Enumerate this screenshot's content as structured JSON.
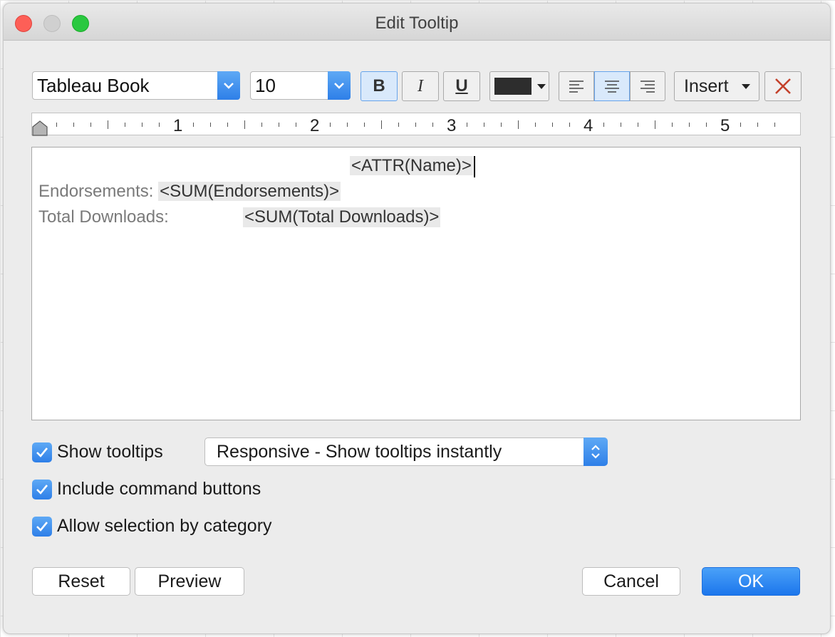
{
  "window": {
    "title": "Edit Tooltip"
  },
  "toolbar": {
    "font_family": "Tableau Book",
    "font_size": "10",
    "bold_label": "B",
    "italic_label": "I",
    "underline_label": "U",
    "text_color": "#2d2d2d",
    "insert_label": "Insert"
  },
  "ruler": {
    "labels": [
      "1",
      "2",
      "3",
      "4",
      "5"
    ]
  },
  "editor": {
    "line1": "<ATTR(Name)>",
    "line2_label": "Endorsements:",
    "line2_field": "<SUM(Endorsements)>",
    "line3_label": "Total Downloads:",
    "line3_field": "<SUM(Total Downloads)>"
  },
  "options": {
    "show_tooltips": {
      "label": "Show tooltips",
      "checked": true
    },
    "tooltip_mode": "Responsive - Show tooltips instantly",
    "include_command_buttons": {
      "label": "Include command buttons",
      "checked": true
    },
    "allow_selection": {
      "label": "Allow selection by category",
      "checked": true
    }
  },
  "buttons": {
    "reset": "Reset",
    "preview": "Preview",
    "cancel": "Cancel",
    "ok": "OK"
  },
  "colors": {
    "accent": "#2e7fe8",
    "field_bg": "#e9e9e9"
  }
}
